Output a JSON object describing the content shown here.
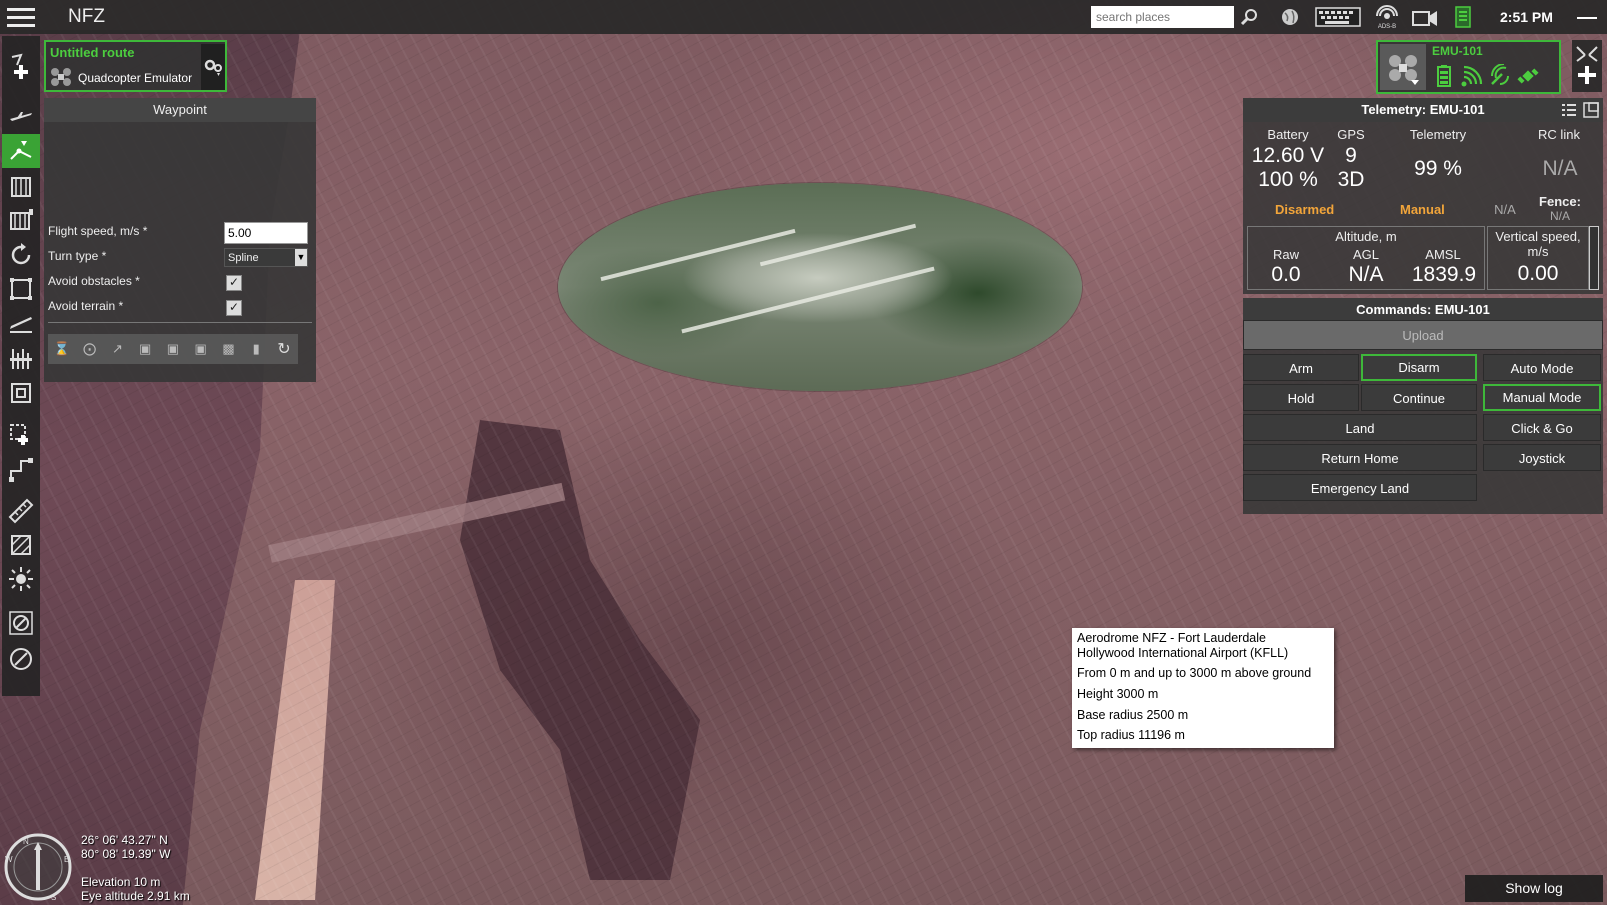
{
  "app": {
    "title": "NFZ"
  },
  "topbar": {
    "search_placeholder": "search places",
    "clock": "2:51 PM",
    "icons": [
      "menu-icon",
      "search-icon",
      "globe-icon",
      "keyboard-icon",
      "adsb-icon",
      "video-icon",
      "battery-device-icon",
      "minimize-icon"
    ]
  },
  "route": {
    "title": "Untitled route",
    "vehicle": "Quadcopter Emulator"
  },
  "waypoint": {
    "header": "Waypoint",
    "flight_speed_label": "Flight speed, m/s *",
    "flight_speed_value": "5.00",
    "turn_type_label": "Turn type *",
    "turn_type_value": "Spline",
    "avoid_obstacles_label": "Avoid obstacles *",
    "avoid_obstacles_checked": true,
    "avoid_terrain_label": "Avoid terrain *",
    "avoid_terrain_checked": true
  },
  "vehicle": {
    "name": "EMU-101"
  },
  "telemetry": {
    "header": "Telemetry: EMU-101",
    "battery_label": "Battery",
    "battery_voltage": "12.60 V",
    "battery_percent": "100 %",
    "gps_label": "GPS",
    "gps_sats": "9",
    "gps_fix": "3D",
    "telemetry_label": "Telemetry",
    "telemetry_value": "99 %",
    "rc_label": "RC link",
    "rc_value": "N/A",
    "armed_state": "Disarmed",
    "mode": "Manual",
    "na_value": "N/A",
    "fence_label": "Fence:",
    "fence_value": "N/A",
    "altitude_label": "Altitude, m",
    "raw_label": "Raw",
    "raw_value": "0.0",
    "agl_label": "AGL",
    "agl_value": "N/A",
    "amsl_label": "AMSL",
    "amsl_value": "1839.9",
    "vs_label": "Vertical speed, m/s",
    "vs_value": "0.00",
    "accent_color": "#f2a53a"
  },
  "commands": {
    "header": "Commands: EMU-101",
    "upload": "Upload",
    "arm": "Arm",
    "disarm": "Disarm",
    "auto_mode": "Auto Mode",
    "hold": "Hold",
    "continue": "Continue",
    "manual_mode": "Manual Mode",
    "land": "Land",
    "click_go": "Click & Go",
    "return_home": "Return Home",
    "joystick": "Joystick",
    "emergency_land": "Emergency Land"
  },
  "nfz_tooltip": {
    "line1": "Aerodrome NFZ - Fort Lauderdale",
    "line2": "Hollywood International Airport (KFLL)",
    "line3": "From 0 m and up to 3000 m above ground",
    "line4": "Height 3000 m",
    "line5": "Base radius 2500 m",
    "line6": "Top radius 11196 m"
  },
  "map_info": {
    "lat": "26° 06' 43.27\" N",
    "lon": "80° 08' 19.39\" W",
    "elevation": "Elevation 10 m",
    "eye_altitude": "Eye altitude 2.91 km"
  },
  "show_log": "Show log",
  "colors": {
    "accent_green": "#3eb83a",
    "title_green": "#4ccd3f",
    "status_orange": "#f2a53a"
  }
}
